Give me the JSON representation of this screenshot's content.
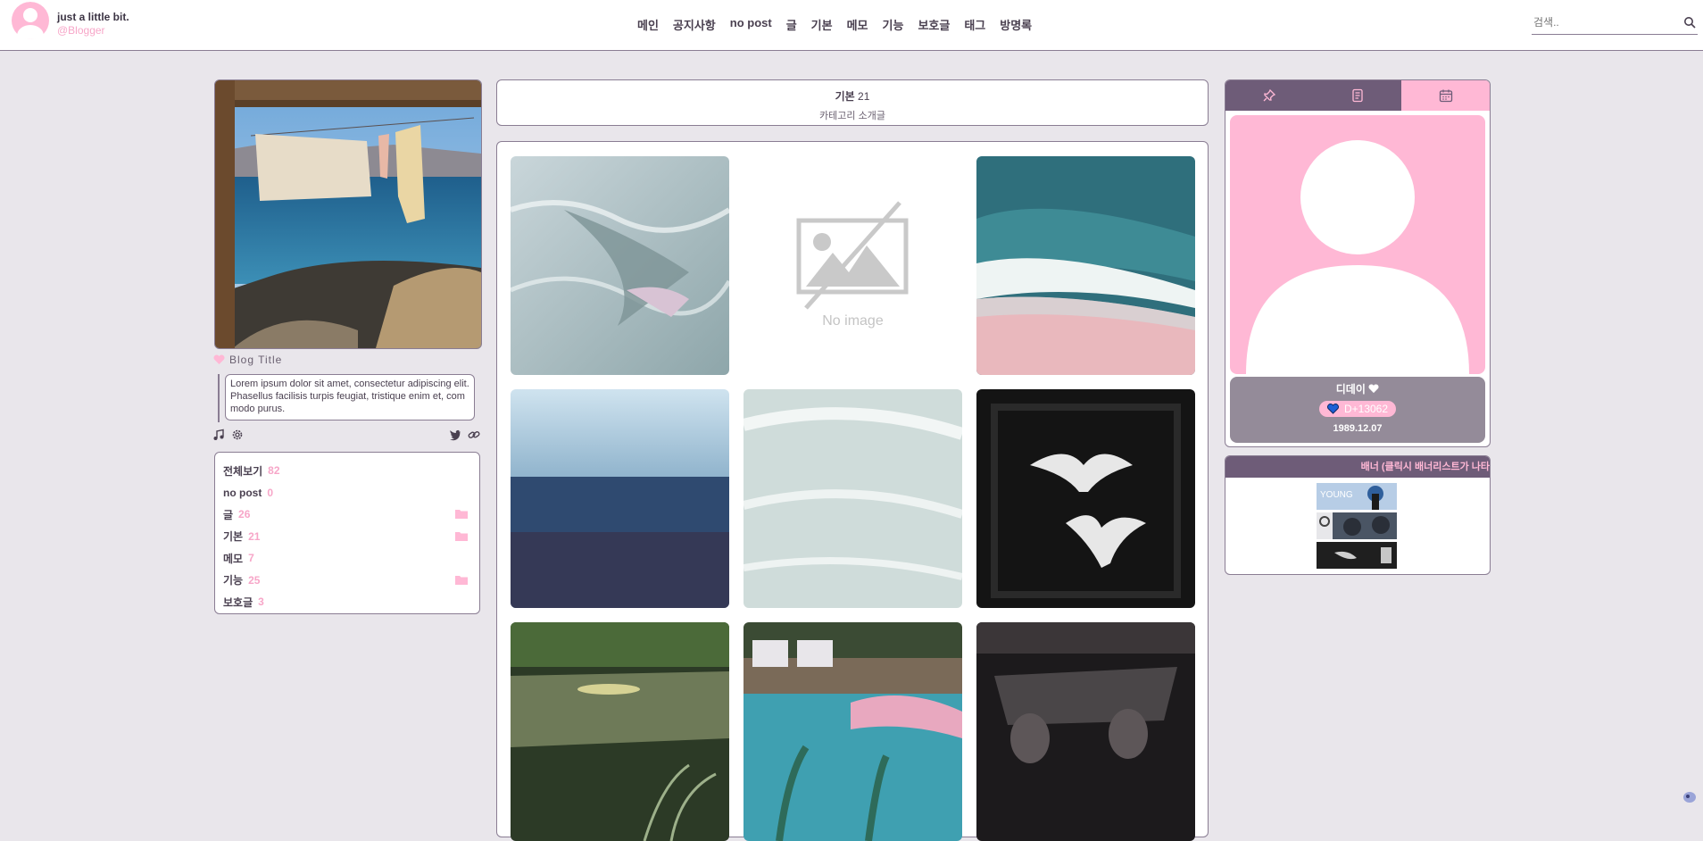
{
  "header": {
    "blog_name": "just a little bit.",
    "blog_sub": "@Blogger",
    "nav": [
      "메인",
      "공지사항",
      "no post",
      "글",
      "기본",
      "메모",
      "기능",
      "보호글",
      "태그",
      "방명록"
    ],
    "search_placeholder": "검색.."
  },
  "sidebar": {
    "blog_title": "Blog Title",
    "description": "Lorem ipsum dolor sit amet, consectetur adipiscing elit.Phasellus facilisis turpis feugiat, tristique enim et, commodo purus.",
    "categories": [
      {
        "label": "전체보기",
        "count": "82"
      },
      {
        "label": "no post",
        "count": "0"
      },
      {
        "label": "글",
        "count": "26"
      },
      {
        "label": "기본",
        "count": "21"
      },
      {
        "label": "메모",
        "count": "7"
      },
      {
        "label": "기능",
        "count": "25"
      },
      {
        "label": "보호글",
        "count": "3"
      }
    ]
  },
  "main": {
    "category_name": "기본",
    "category_count": "21",
    "category_intro": "카테고리 소개글",
    "no_image_label": "No image"
  },
  "right": {
    "dday_title": "디데이",
    "dday_value": "D+13062",
    "dday_date": "1989.12.07",
    "banner_title": "배너 (클릭시 배너리스트가 나타"
  },
  "colors": {
    "accent_pink": "#ffb8d5",
    "purple": "#6e5c78",
    "border": "#8a7d93",
    "background": "#e9e6eb"
  },
  "icons": [
    "user-icon",
    "search-icon",
    "heart-icon",
    "music-icon",
    "gear-icon",
    "twitter-icon",
    "link-icon",
    "folder-icon",
    "pin-icon",
    "document-icon",
    "calendar-icon"
  ]
}
